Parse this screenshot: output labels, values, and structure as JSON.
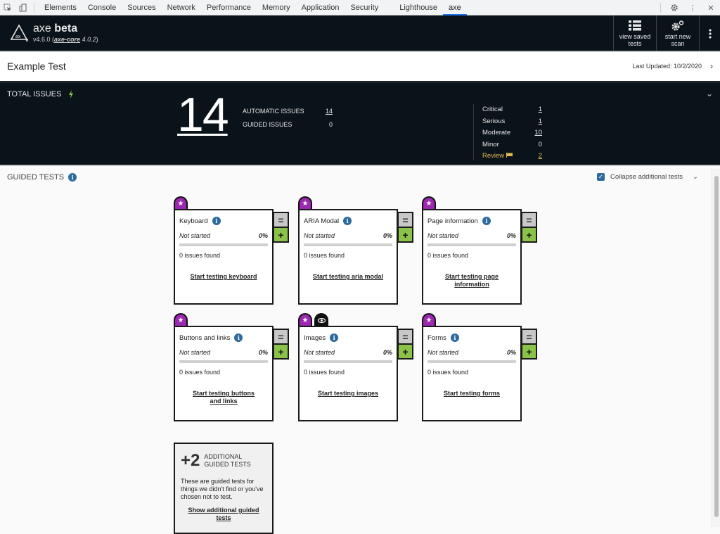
{
  "devtools": {
    "tabs": [
      "Elements",
      "Console",
      "Sources",
      "Network",
      "Performance",
      "Memory",
      "Application",
      "Security",
      "Lighthouse",
      "axe"
    ],
    "active_tab": "axe"
  },
  "header": {
    "brand": "axe",
    "brand_bold": "beta",
    "version": "v4.6.0",
    "core_label": "axe-core",
    "core_version": "4.0.2",
    "view_saved": "view saved tests",
    "start_new": "start new scan"
  },
  "test": {
    "title": "Example Test",
    "last_updated": "Last Updated: 10/2/2020"
  },
  "total_issues": {
    "label": "TOTAL ISSUES",
    "total": "14",
    "types": [
      {
        "label": "AUTOMATIC ISSUES",
        "value": "14",
        "link": true
      },
      {
        "label": "GUIDED ISSUES",
        "value": "0",
        "link": false
      }
    ],
    "severities": [
      {
        "label": "Critical",
        "value": "1",
        "link": true
      },
      {
        "label": "Serious",
        "value": "1",
        "link": true
      },
      {
        "label": "Moderate",
        "value": "10",
        "link": true
      },
      {
        "label": "Minor",
        "value": "0",
        "link": false
      },
      {
        "label": "Review",
        "value": "2",
        "link": true
      }
    ]
  },
  "guided": {
    "label": "GUIDED TESTS",
    "collapse_label": "Collapse additional tests",
    "collapse_checked": true,
    "cards": [
      {
        "title": "Keyboard",
        "status": "Not started",
        "progress_pct": 0,
        "pct_label": "0%",
        "issues": "0 issues found",
        "link": "Start testing keyboard",
        "eye": false
      },
      {
        "title": "ARIA Modal",
        "status": "Not started",
        "progress_pct": 0,
        "pct_label": "0%",
        "issues": "0 issues found",
        "link": "Start testing aria modal",
        "eye": false
      },
      {
        "title": "Page information",
        "status": "Not started",
        "progress_pct": 0,
        "pct_label": "0%",
        "issues": "0 issues found",
        "link": "Start testing page information",
        "eye": false
      },
      {
        "title": "Buttons and links",
        "status": "Not started",
        "progress_pct": 0,
        "pct_label": "0%",
        "issues": "0 issues found",
        "link": "Start testing buttons and links",
        "eye": false
      },
      {
        "title": "Images",
        "status": "Not started",
        "progress_pct": 0,
        "pct_label": "0%",
        "issues": "0 issues found",
        "link": "Start testing images",
        "eye": true
      },
      {
        "title": "Forms",
        "status": "Not started",
        "progress_pct": 0,
        "pct_label": "0%",
        "issues": "0 issues found",
        "link": "Start testing forms",
        "eye": false
      }
    ],
    "additional": {
      "count": "+2",
      "label": "ADDITIONAL GUIDED TESTS",
      "description": "These are guided tests for things we didn't find or you've chosen not to test.",
      "link": "Show additional guided tests"
    }
  },
  "colors": {
    "dark_bg": "#0b131a",
    "accent_purple": "#9c27b0",
    "accent_green": "#8bc34a",
    "info_blue": "#2c6aa0",
    "review_yellow": "#e0b84f"
  }
}
